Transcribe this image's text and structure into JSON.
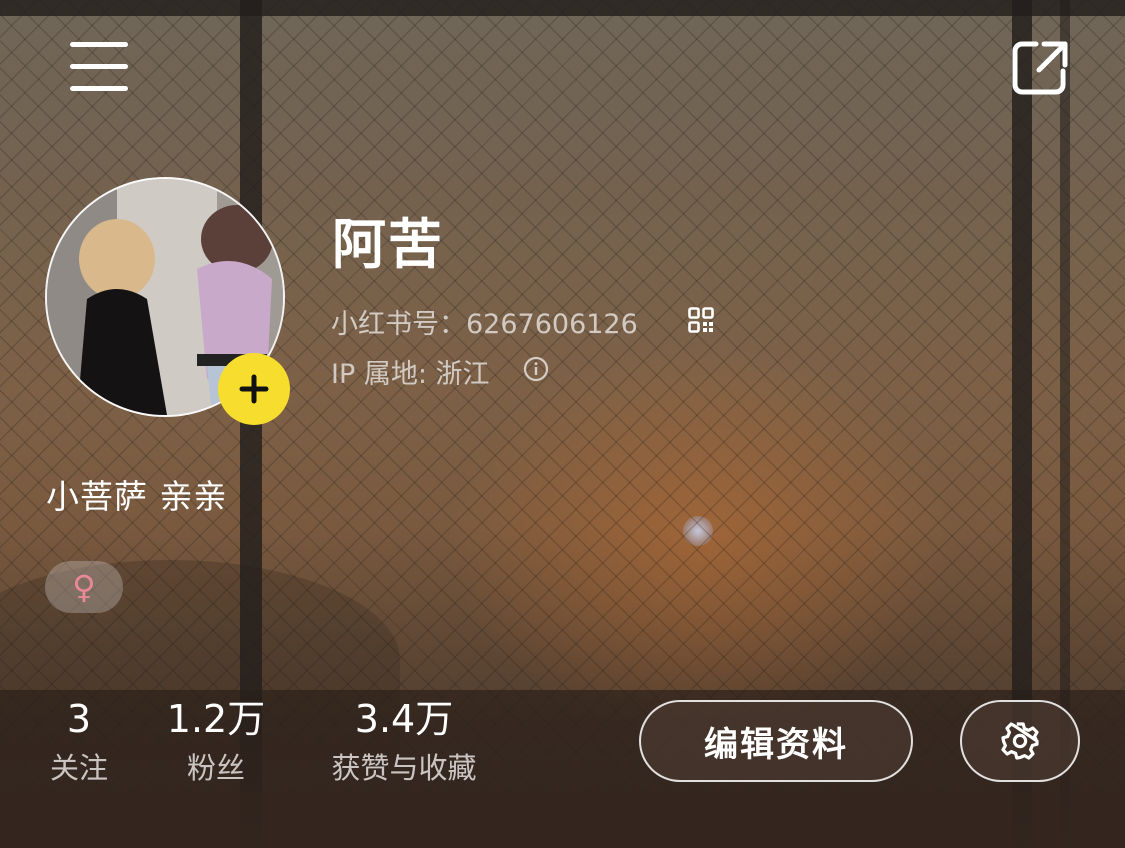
{
  "profile": {
    "nickname": "阿苦",
    "id_line": "小红书号：6267606126",
    "ip_line": "IP 属地: 浙江",
    "signature": "小菩萨 亲亲",
    "gender_symbol": "♀"
  },
  "stats": [
    {
      "value": "3",
      "label": "关注"
    },
    {
      "value": "1.2万",
      "label": "粉丝"
    },
    {
      "value": "3.4万",
      "label": "获赞与收藏"
    }
  ],
  "actions": {
    "edit_label": "编辑资料"
  },
  "icons": {
    "menu": "hamburger-menu-icon",
    "share": "share-external-icon",
    "qr": "qr-code-icon",
    "info": "info-circle-icon",
    "add": "plus-icon",
    "settings": "gear-icon"
  },
  "colors": {
    "add_badge": "#f7de2e",
    "gender_tag": "#e8899a"
  }
}
